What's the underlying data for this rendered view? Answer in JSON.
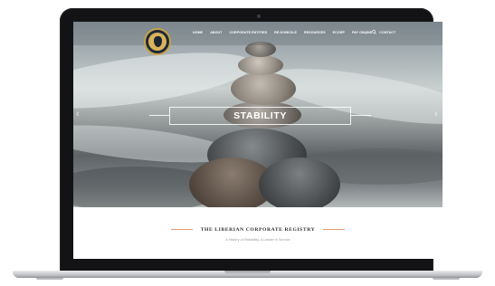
{
  "nav": {
    "items": [
      "HOME",
      "ABOUT",
      "CORPORATE ENTITIES",
      "RE-DOMICILE",
      "RESOURCES",
      "ECORP",
      "PAY ONLINE",
      "CONTACT"
    ],
    "separator": "|"
  },
  "hero": {
    "title": "STABILITY",
    "prev_arrow": "‹",
    "next_arrow": "›"
  },
  "section": {
    "title": "THE LIBERIAN CORPORATE REGISTRY",
    "subtitle": "A History of Reliability. A Leader in Service"
  },
  "icons": {
    "logo": "liberia-registry-seal-icon",
    "search": "search-icon"
  },
  "colors": {
    "accent": "#e79c7a",
    "logo_gold": "#c8a24a",
    "bezel": "#131315"
  }
}
